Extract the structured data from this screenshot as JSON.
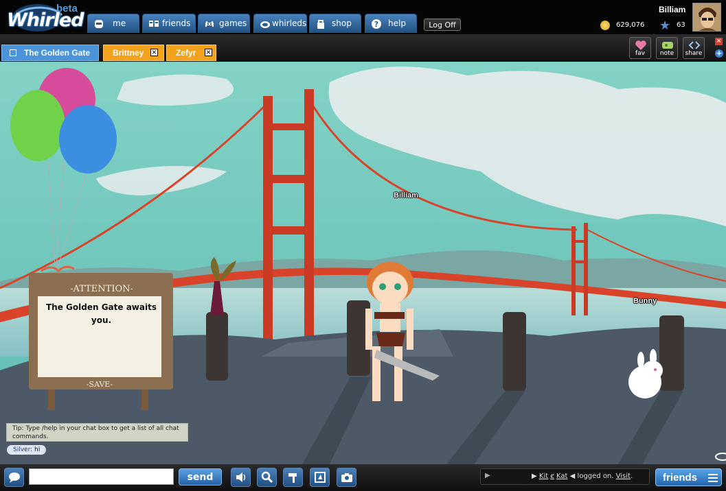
{
  "header": {
    "logo_text": "Whirled",
    "logo_badge": "beta",
    "nav": [
      {
        "label": "me",
        "icon": "face-icon"
      },
      {
        "label": "friends",
        "icon": "friends-icon"
      },
      {
        "label": "games",
        "icon": "invader-icon"
      },
      {
        "label": "whirleds",
        "icon": "whirled-icon"
      },
      {
        "label": "shop",
        "icon": "shop-icon"
      },
      {
        "label": "help",
        "icon": "help-icon"
      }
    ],
    "logoff_label": "Log Off",
    "user_name": "Billiam",
    "coins": "629,076",
    "level": "63"
  },
  "tabs": {
    "room": "The Golden Gate",
    "chats": [
      "Brittney",
      "Zefyr"
    ],
    "close_glyph": "×"
  },
  "tools": {
    "fav": "fav",
    "note": "note",
    "share": "share",
    "close_glyph": "×",
    "plus_glyph": "+"
  },
  "scene": {
    "avatar_name": "Billiam",
    "pet_name": "Bunny",
    "sign_title": "-ATTENTION-",
    "sign_text": "The Golden Gate awaits you.",
    "sign_footer": "-SAVE-",
    "tip": "Tip: Type /help in your chat box to get a list of all chat commands.",
    "chat_speaker": "Silver:",
    "chat_message": "hi"
  },
  "bottom": {
    "chat_value": "",
    "send_label": "send",
    "notice_play": "▶",
    "notice_prefix": "▶",
    "notice_name": "Kit",
    "notice_name2": "Kat",
    "notice_suffix": "◀",
    "notice_text": "logged on.",
    "notice_link": "Visit",
    "notice_end": ".",
    "friends_label": "friends"
  },
  "colors": {
    "accent_blue": "#4b94da",
    "chat_tab_orange": "#f3a21e",
    "sky": "#80cfc4",
    "bridge": "#d8432a"
  }
}
